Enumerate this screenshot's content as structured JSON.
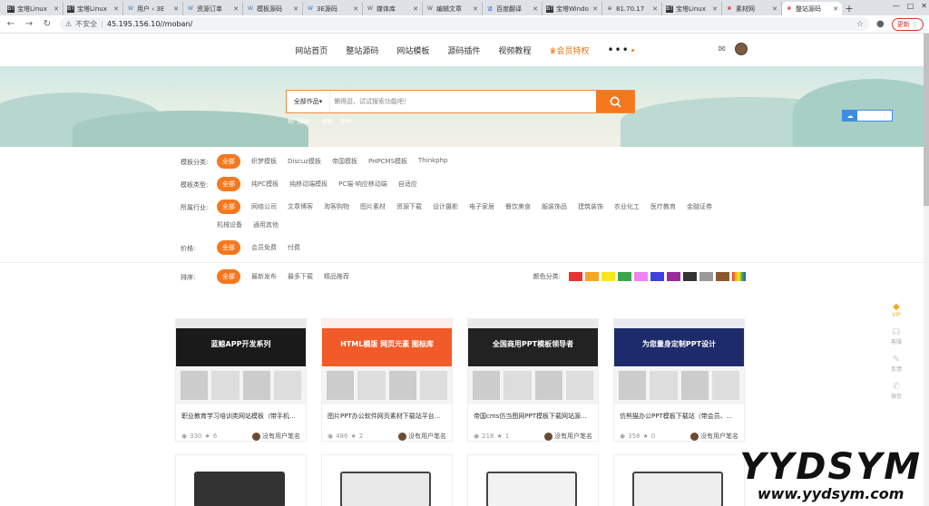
{
  "tabs": [
    {
      "label": "宝塔Linux",
      "icon": "BT",
      "color": "#333"
    },
    {
      "label": "宝塔Linux",
      "icon": "BT",
      "color": "#333"
    },
    {
      "label": "用户 ‹ 3E",
      "icon": "W",
      "color": "#3b7fc4"
    },
    {
      "label": "资源订单",
      "icon": "W",
      "color": "#3b7fc4"
    },
    {
      "label": "模板源码",
      "icon": "W",
      "color": "#3b7fc4"
    },
    {
      "label": "3E源码",
      "icon": "W",
      "color": "#3b7fc4"
    },
    {
      "label": "媒体库",
      "icon": "W",
      "color": "#555"
    },
    {
      "label": "编辑文章",
      "icon": "W",
      "color": "#555"
    },
    {
      "label": "百度翻译",
      "icon": "译",
      "color": "#2b65d8"
    },
    {
      "label": "宝塔Windo",
      "icon": "BT",
      "color": "#333"
    },
    {
      "label": "81.70.17",
      "icon": "⊕",
      "color": "#555"
    },
    {
      "label": "宝塔Linux",
      "icon": "BT",
      "color": "#333"
    },
    {
      "label": "素材网",
      "icon": "❀",
      "color": "#e02b2b"
    },
    {
      "label": "整站源码",
      "icon": "❀",
      "color": "#e02b2b",
      "active": true
    }
  ],
  "browser": {
    "security": "不安全",
    "url": "45.195.156.10//moban/",
    "update_label": "更新"
  },
  "nav": {
    "items": [
      "网站首页",
      "整站源码",
      "网站模板",
      "源码插件",
      "视频教程"
    ],
    "vip": "会员特权"
  },
  "search": {
    "category": "全部作品",
    "placeholder": "懒得逛，试试搜索功能吧！",
    "hot": [
      "热门搜索：",
      "模板",
      "素材"
    ]
  },
  "filters": [
    {
      "label": "模板分类:",
      "options": [
        "全部",
        "织梦模板",
        "Discuz模板",
        "帝国模板",
        "PHPCMS模板",
        "Thinkphp"
      ]
    },
    {
      "label": "模板类型:",
      "options": [
        "全部",
        "纯PC模板",
        "纯移动端模板",
        "PC端-响应移动端",
        "自适应"
      ]
    },
    {
      "label": "所属行业:",
      "options": [
        "全部",
        "网络公司",
        "文章博客",
        "淘客购物",
        "图片素材",
        "资源下载",
        "设计摄影",
        "电子家居",
        "餐饮美食",
        "服装饰品",
        "建筑装饰",
        "农业化工",
        "医疗教育",
        "金融证券",
        "机械设备",
        "通用其他"
      ]
    },
    {
      "label": "价格:",
      "options": [
        "全部",
        "会员免费",
        "付费"
      ]
    },
    {
      "label": "排序:",
      "options": [
        "全部",
        "最新发布",
        "最多下载",
        "精品推荐"
      ]
    }
  ],
  "color_filter": {
    "label": "颜色分类:",
    "colors": [
      "#e63333",
      "#f5a623",
      "#f8e71c",
      "#3aa64b",
      "#ee82ee",
      "#4040e0",
      "#9b2c9b",
      "#333333",
      "#999999",
      "#8b5a2b",
      "rainbow"
    ]
  },
  "cards": [
    {
      "title": "职业教育学习培训类网站模板（带手机...",
      "views": "330",
      "stars": "6",
      "author": "没有用户笔名",
      "banner": "蓝鲸APP开发系列",
      "theme": "#1a1a1a"
    },
    {
      "title": "图片PPT办公软件网页素材下载站平台...",
      "views": "486",
      "stars": "2",
      "author": "没有用户笔名",
      "banner": "HTML模版 网页元素 图标库",
      "theme": "#f15a29"
    },
    {
      "title": "帝国cms仿当图网PPT模板下载网站源...",
      "views": "218",
      "stars": "1",
      "author": "没有用户笔名",
      "banner": "全国商用PPT模板领导者",
      "theme": "#222"
    },
    {
      "title": "仿熊猫办公PPT模板下载站（带会员、...",
      "views": "358",
      "stars": "0",
      "author": "没有用户笔名",
      "banner": "为您量身定制PPT设计",
      "theme": "#1d2b6b"
    }
  ],
  "side": {
    "vip": "VIP",
    "items": [
      "客服",
      "反馈",
      "微信"
    ]
  },
  "watermark": {
    "big": "YYDSYM",
    "small": "www.yydsym.com"
  }
}
